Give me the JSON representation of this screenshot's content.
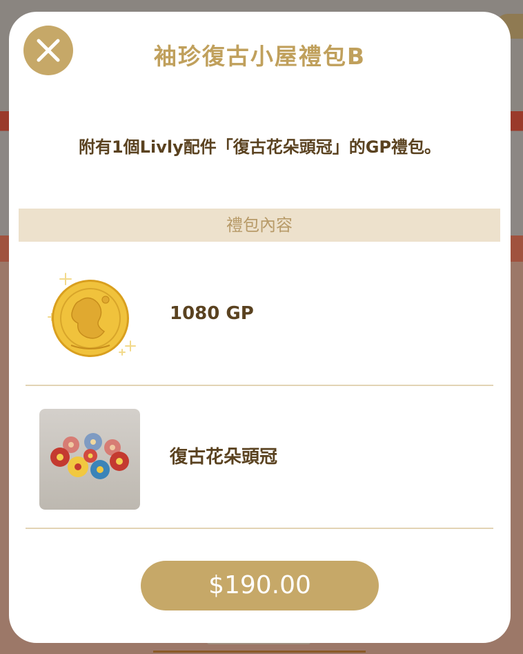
{
  "dialog": {
    "title": "袖珍復古小屋禮包B",
    "description": "附有1個Livly配件「復古花朵頭冠」的GP禮包。",
    "close_icon": "close-icon",
    "section_header": "禮包內容",
    "items": [
      {
        "label": "1080 GP",
        "icon": "gold-coin-icon"
      },
      {
        "label": "復古花朵頭冠",
        "icon": "flower-crown-icon"
      }
    ],
    "price_label": "$190.00"
  },
  "colors": {
    "accent": "#c6a868",
    "title": "#c0a05c",
    "text": "#5a4220",
    "section_bg": "#ede1cc"
  }
}
